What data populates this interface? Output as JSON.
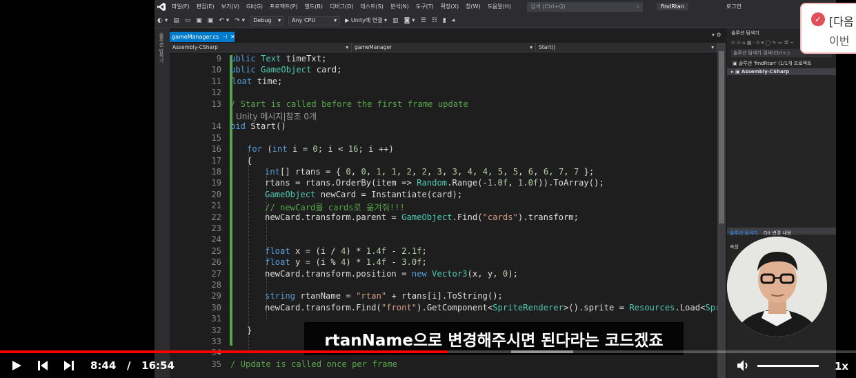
{
  "menubar": {
    "items": [
      "파일(F)",
      "편집(E)",
      "보기(V)",
      "Git(G)",
      "프로젝트(P)",
      "빌드(B)",
      "디버그(D)",
      "테스트(S)",
      "분석(N)",
      "도구(T)",
      "확장(X)",
      "창(W)",
      "도움말(H)"
    ],
    "search_placeholder": "검색 (Ctrl+Q)",
    "solution_title": "findRtan",
    "login": "로그인"
  },
  "toolbar": {
    "config": "Debug",
    "platform": "Any CPU",
    "run": "▶ Unity에 연결 ▾"
  },
  "left_tab": "솔루션 탐색기",
  "editor": {
    "file_tab": "gameManager.cs",
    "nav_project": "Assembly-CSharp",
    "nav_class": "gameManager",
    "nav_member": "Start()"
  },
  "code_lines": [
    {
      "n": "9",
      "code": "ublic Text timeTxt;"
    },
    {
      "n": "10",
      "code": "ublic GameObject card;"
    },
    {
      "n": "11",
      "code": "loat time;"
    },
    {
      "n": "12",
      "code": ""
    },
    {
      "n": "13",
      "code": "/ Start is called before the first frame update"
    },
    {
      "n": "",
      "code": "Unity 메시지|참조 0개"
    },
    {
      "n": "14",
      "code": "oid Start()"
    },
    {
      "n": "15",
      "code": ""
    },
    {
      "n": "16",
      "code": "for (int i = 0; i < 16; i ++)"
    },
    {
      "n": "17",
      "code": "{"
    },
    {
      "n": "18",
      "code": "int[] rtans = { 0, 0, 1, 1, 2, 2, 3, 3, 4, 4, 5, 5, 6, 6, 7, 7 };"
    },
    {
      "n": "19",
      "code": "rtans = rtans.OrderBy(item => Random.Range(-1.0f, 1.0f)).ToArray();"
    },
    {
      "n": "20",
      "code": "GameObject newCard = Instantiate(card);"
    },
    {
      "n": "21",
      "code": "// newCard를 cards로 옮겨줘!!!"
    },
    {
      "n": "22",
      "code": "newCard.transform.parent = GameObject.Find(\"cards\").transform;"
    },
    {
      "n": "23",
      "code": ""
    },
    {
      "n": "24",
      "code": ""
    },
    {
      "n": "25",
      "code": "float x = (i / 4) * 1.4f - 2.1f;"
    },
    {
      "n": "26",
      "code": "float y = (i % 4) * 1.4f - 3.0f;"
    },
    {
      "n": "27",
      "code": "newCard.transform.position = new Vector3(x, y, 0);"
    },
    {
      "n": "28",
      "code": ""
    },
    {
      "n": "29",
      "code": "string rtanName = \"rtan\" + rtans[i].ToString();"
    },
    {
      "n": "30",
      "code": "newCard.transform.Find(\"front\").GetComponent<SpriteRenderer>().sprite = Resources.Load<Sprite>(rtan"
    },
    {
      "n": "31",
      "code": ""
    },
    {
      "n": "32",
      "code": "}"
    },
    {
      "n": "33",
      "code": ""
    },
    {
      "n": "34",
      "code": ""
    },
    {
      "n": "35",
      "code": "/ Update is called once per frame"
    }
  ],
  "right_panel": {
    "title": "솔루션 탐색기",
    "search": "솔루션 탐색기 검색(Ctrl+;)",
    "solution": "솔루션 'findRtan' (1/1개 프로젝트",
    "project": "Assembly-CSharp",
    "tab1": "솔루션 탐색기",
    "tab2": "Git 변경 내용",
    "props": "속성"
  },
  "notification": {
    "line1": "[다음",
    "line2": "이번 "
  },
  "subtitle": "rtanName으로 변경해주시면 된다라는 코드겠죠",
  "player": {
    "current": "8:44",
    "separator": "/",
    "duration": "16:54",
    "speed": "1x",
    "progress": 0.517
  },
  "colors": {
    "accent": "#007acc",
    "progress": "#ff0000",
    "green": "#57a64a"
  }
}
